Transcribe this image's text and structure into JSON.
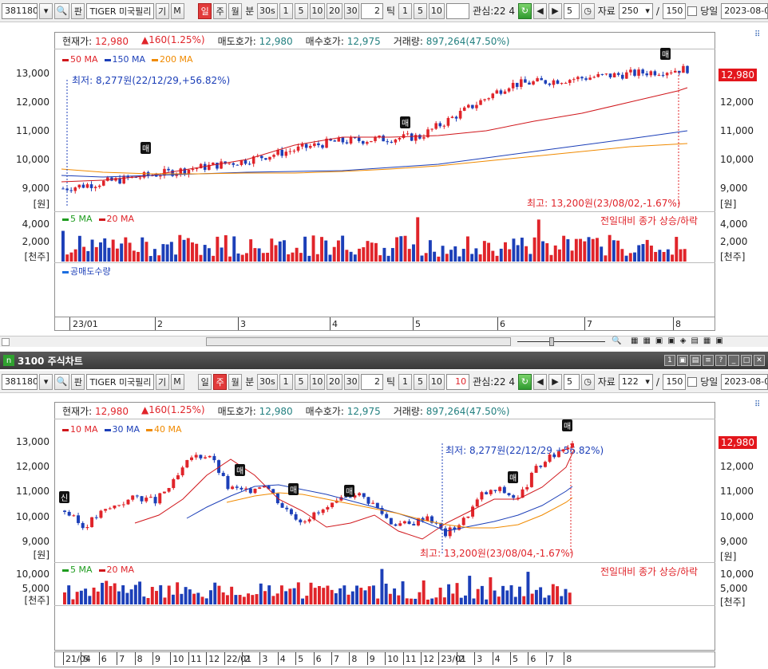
{
  "toolbar": {
    "code": "381180",
    "search_label": "🔍",
    "fan_label": "판",
    "name": "TIGER 미국필리",
    "gi_label": "기",
    "m_label": "M",
    "period_labels": [
      "일",
      "주",
      "월",
      "분"
    ],
    "minute_labels": [
      "30s",
      "1",
      "5",
      "10",
      "20",
      "30"
    ],
    "tick_value": "2",
    "tick_label": "틱",
    "tick_options": [
      "1",
      "5",
      "10"
    ],
    "interest": "관심:22 4",
    "jump_value": "5",
    "data_label": "자료",
    "slash": "/",
    "same_day_label": "당일",
    "date": "2023-08-0"
  },
  "top": {
    "count": "250",
    "page": "150",
    "active_period": "일"
  },
  "bottom": {
    "count": "122",
    "page": "150",
    "active_period": "주",
    "tick_active": "10"
  },
  "quote": {
    "current_label": "현재가:",
    "current": "12,980",
    "change": "▲160(1.25%)",
    "ask_label": "매도호가:",
    "ask": "12,980",
    "bid_label": "매수호가:",
    "bid": "12,975",
    "volume_label": "거래량:",
    "volume": "897,264(47.50%)"
  },
  "top_chart": {
    "ma_legend": [
      {
        "label": "50 MA",
        "color": "#d0161b"
      },
      {
        "label": "150 MA",
        "color": "#1c3fb8"
      },
      {
        "label": "200 MA",
        "color": "#f08a00"
      }
    ],
    "low_note": "최저: 8,277원(22/12/29,+56.82%)",
    "high_note": "최고: 13,200원(23/08/02,-1.67%)",
    "last_price": "12,980",
    "y_labels": [
      "13,000",
      "12,000",
      "11,000",
      "10,000",
      "9,000"
    ],
    "unit": "[원]",
    "vol_legend": [
      {
        "label": "5 MA",
        "color": "#1f9c1f"
      },
      {
        "label": "20 MA",
        "color": "#d0161b"
      }
    ],
    "vol_note": "전일대비 종가 상승/하락",
    "vol_y": [
      "4,000",
      "2,000"
    ],
    "vol_unit": "[천주]",
    "short_label": "공매도수량",
    "x_labels": [
      "23/01",
      "2",
      "3",
      "4",
      "5",
      "6",
      "7",
      "8"
    ],
    "signal": "매"
  },
  "window_title": "3100 주식차트",
  "bottom_chart": {
    "ma_legend": [
      {
        "label": "10 MA",
        "color": "#d0161b"
      },
      {
        "label": "30 MA",
        "color": "#1c3fb8"
      },
      {
        "label": "40 MA",
        "color": "#f08a00"
      }
    ],
    "low_note": "최저: 8,277원(22/12/29,+56.82%)",
    "high_note": "최고: 13,200원(23/08/04,-1.67%)",
    "last_price": "12,980",
    "y_labels": [
      "13,000",
      "12,000",
      "11,000",
      "10,000",
      "9,000"
    ],
    "unit": "[원]",
    "vol_legend": [
      {
        "label": "5 MA",
        "color": "#1f9c1f"
      },
      {
        "label": "20 MA",
        "color": "#d0161b"
      }
    ],
    "vol_note": "전일대비 종가 상승/하락",
    "vol_y": [
      "10,000",
      "5,000"
    ],
    "vol_unit": "[천주]",
    "x_labels": [
      "21/04",
      "5",
      "6",
      "7",
      "8",
      "9",
      "10",
      "11",
      "12",
      "22/01",
      "2",
      "3",
      "4",
      "5",
      "6",
      "7",
      "8",
      "9",
      "10",
      "11",
      "12",
      "23/01",
      "2",
      "3",
      "4",
      "5",
      "6",
      "7",
      "8"
    ],
    "signal_new": "신",
    "signal": "매"
  },
  "chart_data": [
    {
      "type": "candlestick",
      "title": "",
      "period": "daily",
      "x": [
        "23/01",
        "2",
        "3",
        "4",
        "5",
        "6",
        "7",
        "8"
      ],
      "ylim": [
        8277,
        13200
      ],
      "series_close": [
        8600,
        9100,
        9600,
        10300,
        10500,
        12400,
        12700,
        12980
      ],
      "ma": [
        "50 MA",
        "150 MA",
        "200 MA"
      ],
      "low": {
        "value": 8277,
        "date": "22/12/29"
      },
      "high": {
        "value": 13200,
        "date": "23/08/02"
      },
      "last": 12980
    },
    {
      "type": "candlestick",
      "title": "",
      "period": "weekly",
      "x": [
        "21/04",
        "5",
        "6",
        "7",
        "8",
        "9",
        "10",
        "11",
        "12",
        "22/01",
        "2",
        "3",
        "4",
        "5",
        "6",
        "7",
        "8",
        "9",
        "10",
        "11",
        "12",
        "23/01",
        "2",
        "3",
        "4",
        "5",
        "6",
        "7",
        "8"
      ],
      "ylim": [
        8277,
        13200
      ],
      "series_close": [
        10000,
        9300,
        9900,
        10300,
        10600,
        10400,
        11200,
        12300,
        12400,
        11000,
        10800,
        11200,
        10200,
        9600,
        9900,
        10300,
        10800,
        10300,
        9500,
        9400,
        9800,
        9000,
        9600,
        10700,
        10900,
        10500,
        11800,
        12400,
        12980
      ],
      "ma": [
        "10 MA",
        "30 MA",
        "40 MA"
      ],
      "low": {
        "value": 8277,
        "date": "22/12/29"
      },
      "high": {
        "value": 13200,
        "date": "23/08/04"
      },
      "last": 12980
    }
  ]
}
